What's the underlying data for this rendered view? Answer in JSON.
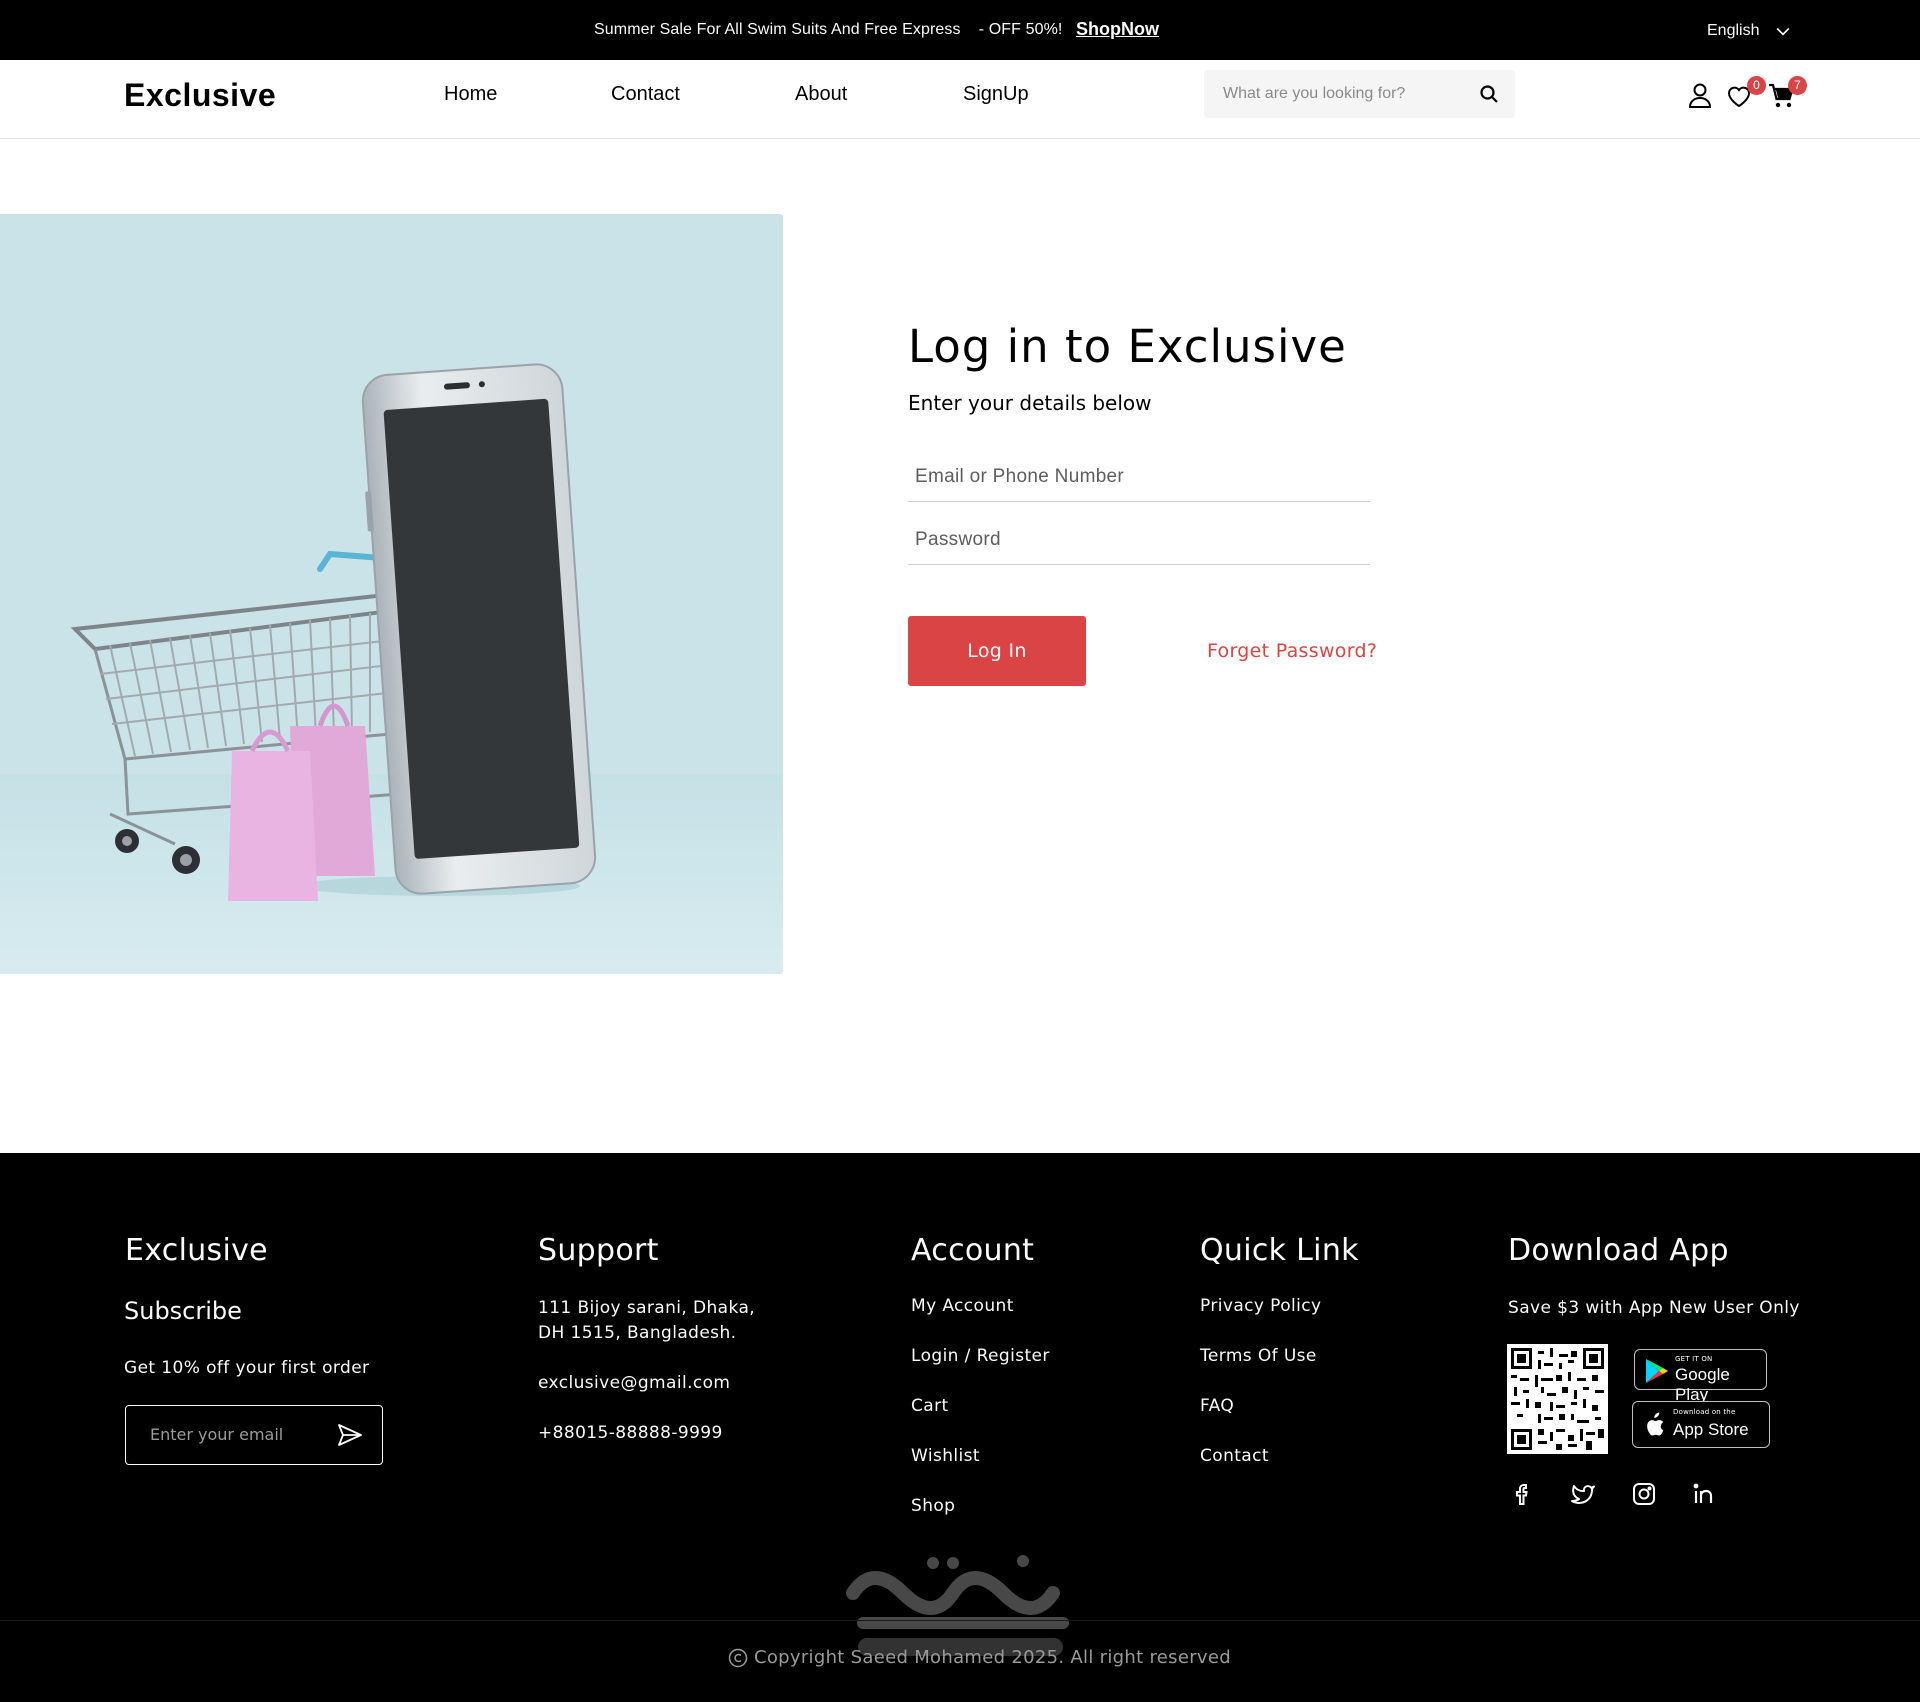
{
  "topbar": {
    "promo": "Summer Sale For All Swim Suits And Free Express    - OFF 50%!",
    "shop_now": "ShopNow",
    "language": "English"
  },
  "header": {
    "logo": "Exclusive",
    "nav": [
      "Home",
      "Contact",
      "About",
      "SignUp"
    ],
    "search_placeholder": "What are you looking for?",
    "wishlist_count": "0",
    "cart_count": "7"
  },
  "login": {
    "title": "Log in to Exclusive",
    "subtitle": "Enter your details below",
    "email_placeholder": "Email or Phone Number",
    "password_placeholder": "Password",
    "login_button": "Log In",
    "forget_password": "Forget Password?"
  },
  "footer": {
    "brand": {
      "title": "Exclusive",
      "subscribe": "Subscribe",
      "offer": "Get 10% off your first order",
      "email_placeholder": "Enter your email"
    },
    "support": {
      "title": "Support",
      "address_line1": "111 Bijoy sarani, Dhaka,",
      "address_line2": "DH 1515, Bangladesh.",
      "email": "exclusive@gmail.com",
      "phone": "+88015-88888-9999"
    },
    "account": {
      "title": "Account",
      "links": [
        "My Account",
        "Login / Register",
        "Cart",
        "Wishlist",
        "Shop"
      ]
    },
    "quick_link": {
      "title": "Quick Link",
      "links": [
        "Privacy Policy",
        "Terms Of Use",
        "FAQ",
        "Contact"
      ]
    },
    "download": {
      "title": "Download App",
      "tagline": "Save $3 with App New User Only",
      "google_small": "GET IT ON",
      "google_big": "Google Play",
      "apple_small": "Download on the",
      "apple_big": "App Store"
    },
    "copyright": "Copyright Saeed Mohamed 2025. All right reserved"
  },
  "colors": {
    "accent": "#DB4444",
    "topbar_bg": "#000000",
    "hero_bg": "#CBE4E8"
  }
}
